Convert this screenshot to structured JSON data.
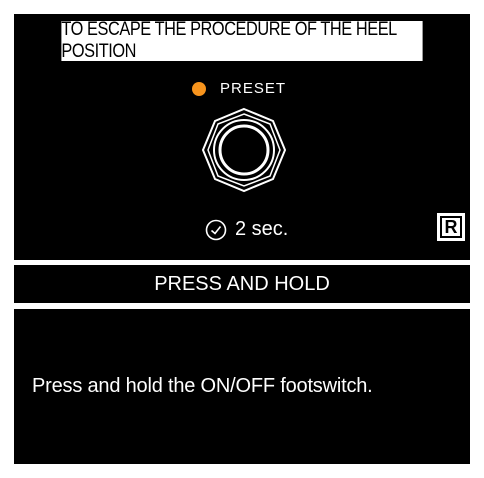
{
  "title": "TO ESCAPE THE PROCEDURE OF THE HEEL POSITION",
  "indicator": {
    "label": "PRESET",
    "led_color": "#f7941d",
    "led_icon": "led-dot-icon"
  },
  "footswitch": {
    "icon": "footswitch-icon"
  },
  "timer": {
    "icon": "clock-icon",
    "text": "2 sec."
  },
  "badge": {
    "text": "R"
  },
  "action_bar": {
    "text": "PRESS AND HOLD"
  },
  "instruction": {
    "text": "Press and hold the ON/OFF footswitch."
  },
  "colors": {
    "panel": "#000000",
    "text_light": "#ffffff",
    "accent": "#f7941d"
  }
}
